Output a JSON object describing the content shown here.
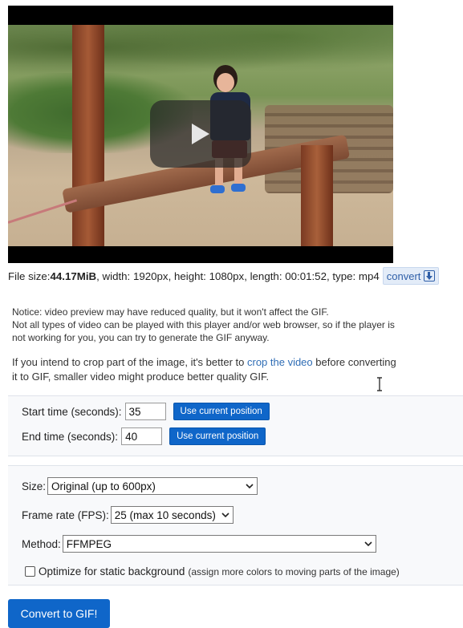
{
  "video": {
    "player_label": "video-preview"
  },
  "fileinfo": {
    "size_label": "File size: ",
    "size_value": "44.17MiB",
    "rest": ", width: 1920px, height: 1080px, length: 00:01:52, type: mp4",
    "convert_label": "convert"
  },
  "notice": {
    "line1": "Notice: video preview may have reduced quality, but it won't affect the GIF.",
    "line2": "Not all types of video can be played with this player and/or web browser, so if the player is",
    "line3": "not working for you, you can try to generate the GIF anyway."
  },
  "crop": {
    "before": "If you intend to crop part of the image, it's better to ",
    "link": "crop the video",
    "after1": " before converting",
    "line2": "it to GIF, smaller video might produce better quality GIF."
  },
  "timing": {
    "start_label": "Start time (seconds):",
    "start_value": "35",
    "end_label": "End time (seconds):",
    "end_value": "40",
    "use_current": "Use current position"
  },
  "options": {
    "size_label": "Size:",
    "size_value": "Original (up to 600px)",
    "fps_label": "Frame rate (FPS):",
    "fps_value": "25 (max 10 seconds)",
    "method_label": "Method:",
    "method_value": "FFMPEG",
    "optimize_label": "Optimize for static background",
    "optimize_hint": "(assign more colors to moving parts of the image)",
    "optimize_checked": false
  },
  "submit_label": "Convert to GIF!"
}
